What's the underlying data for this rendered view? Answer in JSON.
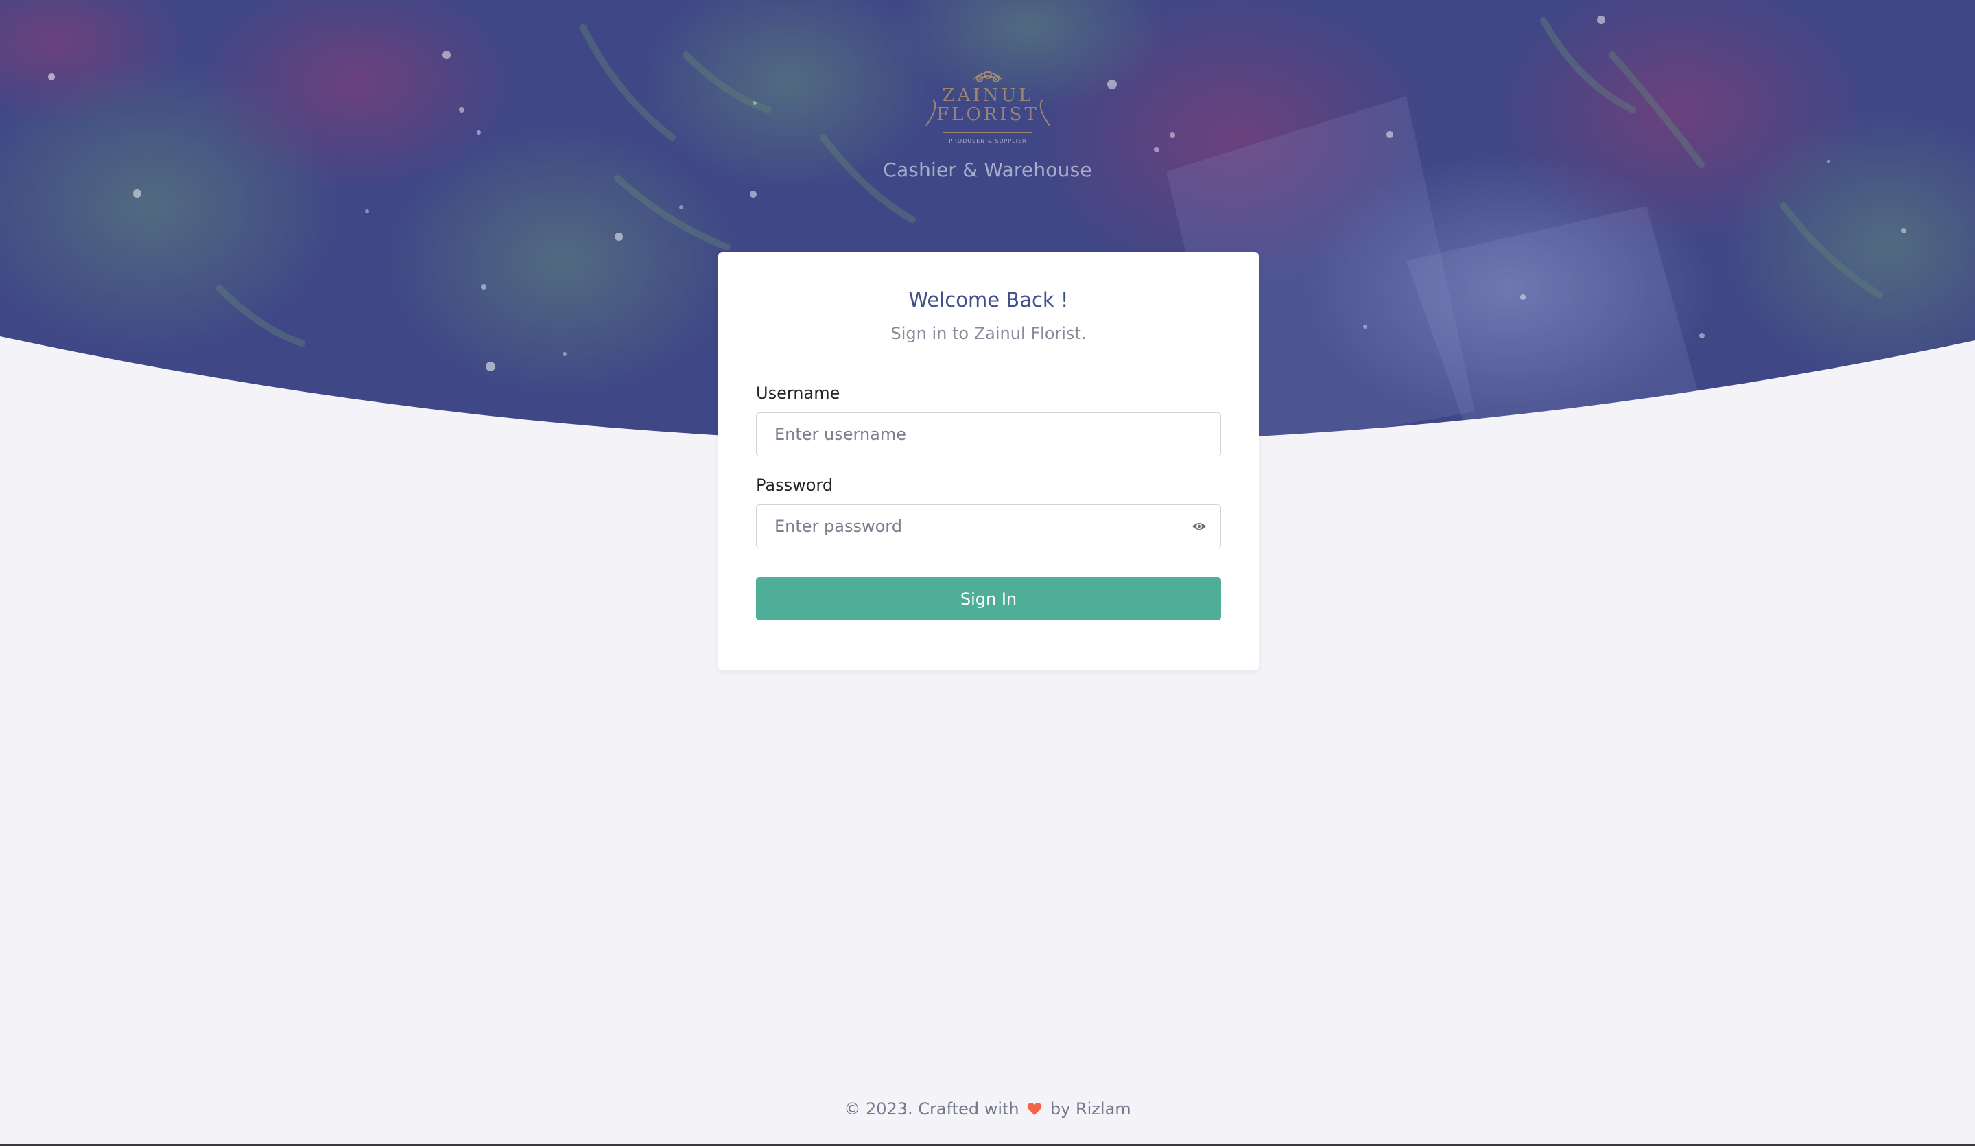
{
  "brand": {
    "logo_text_line1": "ZAINUL",
    "logo_text_line2": "FLORIST",
    "logo_text_line3": "PRODUSEN & SUPPLIER",
    "tagline": "Cashier & Warehouse"
  },
  "login": {
    "title": "Welcome Back !",
    "subtitle": "Sign in to Zainul Florist.",
    "username_label": "Username",
    "username_placeholder": "Enter username",
    "username_value": "",
    "password_label": "Password",
    "password_placeholder": "Enter password",
    "password_value": "",
    "submit_label": "Sign In"
  },
  "footer": {
    "prefix": "© 2023. Crafted with",
    "suffix": "by Rizlam",
    "heart_icon": "heart-icon"
  },
  "colors": {
    "hero_overlay": "#4a5394",
    "page_bg": "#f3f3f8",
    "title": "#405189",
    "button": "#4fae98",
    "heart": "#f06548"
  }
}
